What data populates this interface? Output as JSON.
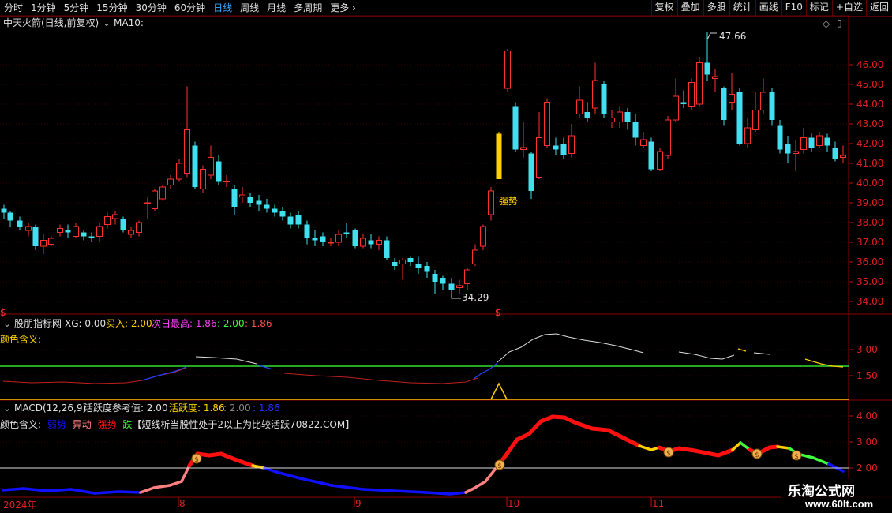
{
  "toolbar": {
    "periods": [
      "分时",
      "1分钟",
      "5分钟",
      "15分钟",
      "30分钟",
      "60分钟",
      "日线",
      "周线",
      "月线",
      "多周期",
      "更多"
    ],
    "active_period": "日线",
    "right_buttons": [
      "复权",
      "叠加",
      "多股",
      "统计",
      "画线",
      "F10",
      "标记",
      "+自选",
      "返回"
    ]
  },
  "main": {
    "title": "中天火箭(日线,前复权)",
    "ma_label": "MA10:",
    "high_label": "47.66",
    "low_label": "34.29",
    "signal_text": "强势",
    "yaxis": [
      "46.00",
      "45.00",
      "44.00",
      "43.00",
      "42.00",
      "41.00",
      "40.00",
      "39.00",
      "38.00",
      "37.00",
      "36.00",
      "35.00",
      "34.00"
    ]
  },
  "panel2": {
    "name": "股朋指标网",
    "xg": "XG: 0.00",
    "buy": "买入: 2.00",
    "next_high": "次日最高: 1.86",
    "v2": ": 2.00",
    "v3": ": 1.86",
    "legend": "颜色含义:",
    "yaxis": [
      "3.00",
      "1.50"
    ]
  },
  "panel3": {
    "name": "MACD(12,26,9)",
    "ref": "活跃度参考值: 2.00",
    "act": "活跃度: 1.86",
    "v2": ": 2.00",
    "v3": ": 1.86",
    "legend_prefix": "颜色含义:",
    "legend_weak": "弱势",
    "legend_abn": "异动",
    "legend_strong": "强势",
    "legend_fall": "跌",
    "legend_note": "【短线析当股性处于2以上为比较活跃70822.COM】",
    "yaxis": [
      "4.00",
      "3.00",
      "2.00"
    ]
  },
  "xaxis": [
    "2024年",
    "8",
    "9",
    "10",
    "11"
  ],
  "colors": {
    "up": "#ff3030",
    "down": "#40e0f0",
    "highlight": "#ffd000",
    "weak": "#1010ff",
    "strong": "#ff1010",
    "abnormal": "#ff8080"
  },
  "watermark": {
    "line1": "乐淘公式网",
    "line2": "www.60lt.com"
  }
}
